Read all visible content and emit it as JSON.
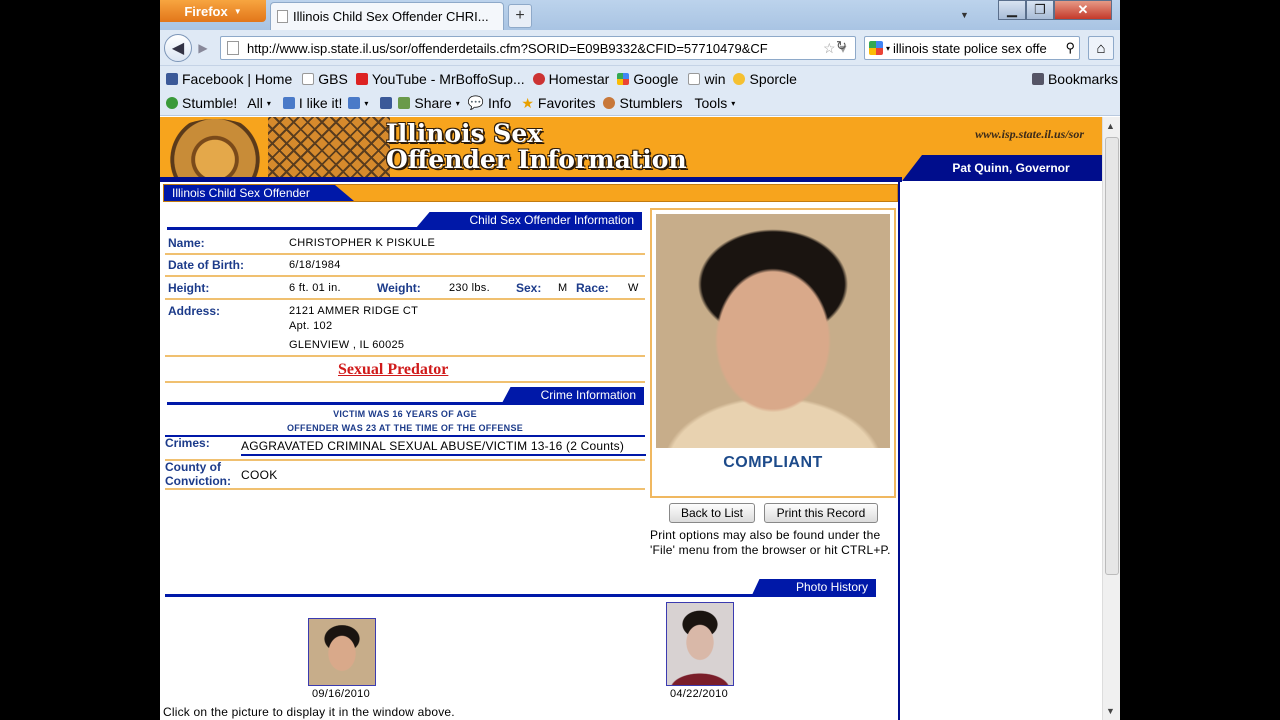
{
  "browser": {
    "app_button": "Firefox",
    "tab_title": "Illinois Child Sex Offender CHRI...",
    "new_tab": "+",
    "url": "http://www.isp.state.il.us/sor/offenderdetails.cfm?SORID=E09B9332&CFID=57710479&CF",
    "search_text": "illinois state police sex offe"
  },
  "bookmarks": [
    "Facebook | Home",
    "GBS",
    "YouTube - MrBoffoSup...",
    "Homestar",
    "Google",
    "win",
    "Sporcle"
  ],
  "bookmarks_menu": "Bookmarks",
  "stumble_toolbar": {
    "stumble": "Stumble!",
    "all": "All",
    "ilike": "I like it!",
    "share": "Share",
    "info": "Info",
    "favorites": "Favorites",
    "stumblers": "Stumblers",
    "tools": "Tools"
  },
  "banner": {
    "title_line1": "Illinois Sex",
    "title_line2": "Offender Information",
    "site": "www.isp.state.il.us/sor",
    "governor": "Pat Quinn, Governor"
  },
  "section_title": "Illinois Child Sex Offender",
  "offender": {
    "header": "Child Sex Offender Information",
    "name_label": "Name:",
    "name": "CHRISTOPHER K PISKULE",
    "dob_label": "Date of Birth:",
    "dob": "6/18/1984",
    "height_label": "Height:",
    "height": "6 ft. 01 in.",
    "weight_label": "Weight:",
    "weight": "230 lbs.",
    "sex_label": "Sex:",
    "sex": "M",
    "race_label": "Race:",
    "race": "W",
    "address_label": "Address:",
    "address1": "2121 AMMER RIDGE CT",
    "address2": "Apt. 102",
    "address3": "GLENVIEW , IL 60025",
    "designation": "Sexual Predator"
  },
  "crime": {
    "header": "Crime Information",
    "victim_age": "VICTIM WAS 16 YEARS OF AGE",
    "offender_age": "OFFENDER WAS 23 AT THE TIME OF THE OFFENSE",
    "crimes_label": "Crimes:",
    "crimes": "AGGRAVATED CRIMINAL SEXUAL ABUSE/VICTIM 13-16 (2 Counts)",
    "county_label1": "County of",
    "county_label2": "Conviction:",
    "county": "COOK"
  },
  "status": "COMPLIANT",
  "buttons": {
    "back": "Back to List",
    "print": "Print this Record"
  },
  "print_note": "Print options may also be found under the 'File' menu from the browser or hit CTRL+P.",
  "photo_history": {
    "header": "Photo History",
    "dates": [
      "09/16/2010",
      "04/22/2010"
    ],
    "note": "Click on the picture to display it in the window above."
  }
}
